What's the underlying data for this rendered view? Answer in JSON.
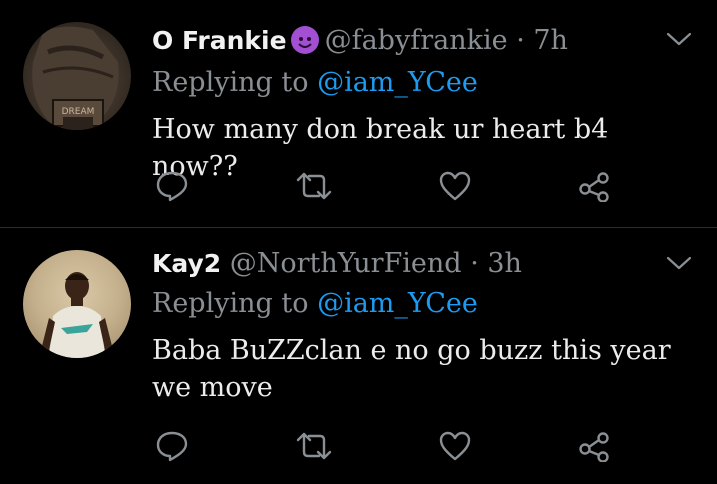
{
  "tweets": [
    {
      "name": "O Frankie",
      "emoji": "smiling-imp-emoji",
      "handle": "@fabyfrankie",
      "sep": "·",
      "time": "7h",
      "replying_prefix": "Replying to ",
      "replying_to": "@iam_YCee",
      "text": "How many don break ur heart b4 now??",
      "avatar": "tattoo-avatar",
      "avatar_text": "DREAM"
    },
    {
      "name": "Kay2",
      "handle": "@NorthYurFiend",
      "sep": "·",
      "time": "3h",
      "replying_prefix": "Replying to ",
      "replying_to": "@iam_YCee",
      "text": "Baba BuZZclan e no go buzz this year we move",
      "avatar": "person-avatar"
    }
  ],
  "icons": {
    "reply": "reply-icon",
    "retweet": "retweet-icon",
    "like": "heart-icon",
    "share": "share-icon",
    "menu": "chevron-down-icon"
  },
  "colors": {
    "background": "#000000",
    "link": "#1d9bf0",
    "muted": "#8a8f94",
    "text": "#ececec"
  }
}
